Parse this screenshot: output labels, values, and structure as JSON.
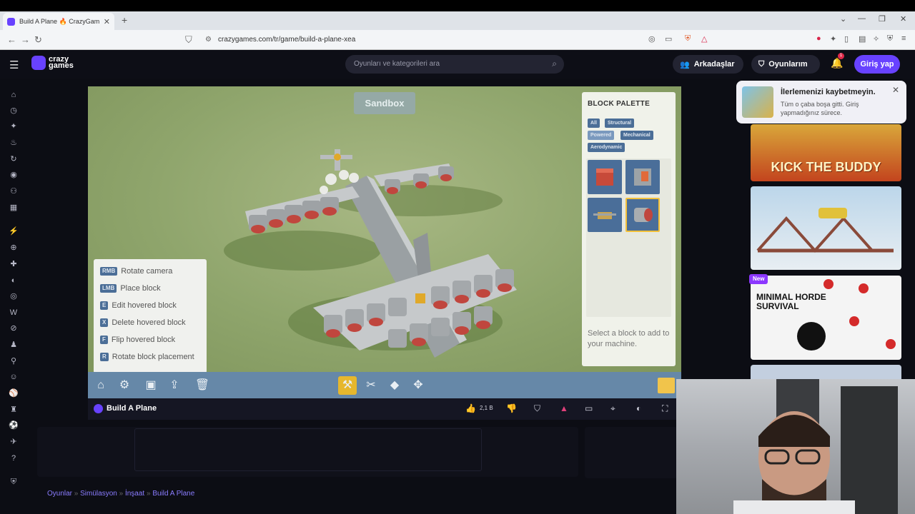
{
  "browser": {
    "tab_title": "Build A Plane 🔥 CrazyGames",
    "url": "crazygames.com/tr/game/build-a-plane-xea"
  },
  "site": {
    "logo_line1": "crazy",
    "logo_line2": "games",
    "search_placeholder": "Oyunları ve kategorileri ara",
    "friends_label": "Arkadaşlar",
    "my_games_label": "Oyunlarım",
    "notification_count": "1",
    "login_label": "Giriş yap"
  },
  "game": {
    "mode_label": "Sandbox",
    "palette": {
      "title": "BLOCK PALETTE",
      "filters": [
        "All",
        "Structural",
        "Powered",
        "Mechanical",
        "Aerodynamic"
      ],
      "hint": "Select a block to add to your machine."
    },
    "keys": [
      {
        "key": "RMB",
        "action": "Rotate camera"
      },
      {
        "key": "LMB",
        "action": "Place block"
      },
      {
        "key": "E",
        "action": "Edit hovered block"
      },
      {
        "key": "X",
        "action": "Delete hovered block"
      },
      {
        "key": "F",
        "action": "Flip hovered block"
      },
      {
        "key": "R",
        "action": "Rotate block placement"
      }
    ],
    "name": "Build A Plane",
    "likes": "2,1 B"
  },
  "notification": {
    "title": "İlerlemenizi kaybetmeyin.",
    "body": "Tüm o çaba boşa gitti. Giriş yapmadığınız sürece."
  },
  "cards": [
    {
      "title": "KICK THE BUDDY"
    },
    {
      "title": ""
    },
    {
      "title": "MINIMAL HORDE SURVIVAL",
      "badge": "New"
    },
    {
      "title": ""
    }
  ],
  "breadcrumbs": [
    "Oyunlar",
    "Simülasyon",
    "İnşaat",
    "Build A Plane"
  ]
}
